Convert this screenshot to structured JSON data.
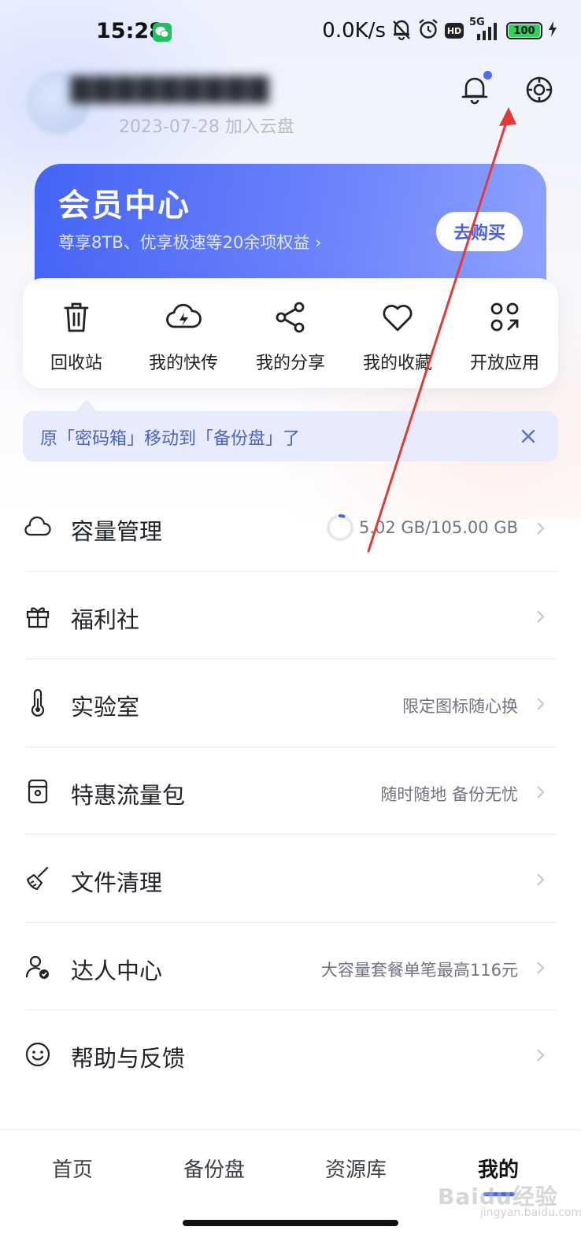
{
  "status_bar": {
    "time": "15:28",
    "net_speed": "0.0K/s",
    "hd_label": "HD",
    "network": "5G",
    "battery": "100"
  },
  "header": {
    "join_date": "2023-07-28 加入云盘"
  },
  "vip": {
    "title": "会员中心",
    "subtitle": "尊享8TB、优享极速等20余项权益 ›",
    "buy_label": "去购买"
  },
  "quick_actions": [
    {
      "label": "回收站",
      "icon": "trash-icon"
    },
    {
      "label": "我的快传",
      "icon": "cloud-lightning-icon"
    },
    {
      "label": "我的分享",
      "icon": "share-icon"
    },
    {
      "label": "我的收藏",
      "icon": "heart-icon"
    },
    {
      "label": "开放应用",
      "icon": "apps-icon"
    }
  ],
  "notice": {
    "text": "原「密码箱」移动到「备份盘」了"
  },
  "menu": [
    {
      "label": "容量管理",
      "value": "5.02 GB/105.00 GB",
      "icon": "cloud-icon",
      "usage_fraction": 0.048
    },
    {
      "label": "福利社",
      "value": "",
      "icon": "gift-icon"
    },
    {
      "label": "实验室",
      "value": "限定图标随心换",
      "icon": "thermometer-icon"
    },
    {
      "label": "特惠流量包",
      "value": "随时随地 备份无忧",
      "icon": "data-pack-icon"
    },
    {
      "label": "文件清理",
      "value": "",
      "icon": "broom-icon"
    },
    {
      "label": "达人中心",
      "value": "大容量套餐单笔最高116元",
      "icon": "user-badge-icon"
    },
    {
      "label": "帮助与反馈",
      "value": "",
      "icon": "smile-icon"
    }
  ],
  "bottom_nav": [
    {
      "label": "首页",
      "active": false
    },
    {
      "label": "备份盘",
      "active": false
    },
    {
      "label": "资源库",
      "active": false
    },
    {
      "label": "我的",
      "active": true
    }
  ],
  "watermark": {
    "brand": "Baidu经验",
    "url": "jingyan.baidu.com"
  },
  "colors": {
    "accent": "#4564f6",
    "notice_bg": "#e7ebfb",
    "notice_text": "#4d63c9",
    "annotation_arrow": "#e53935"
  }
}
